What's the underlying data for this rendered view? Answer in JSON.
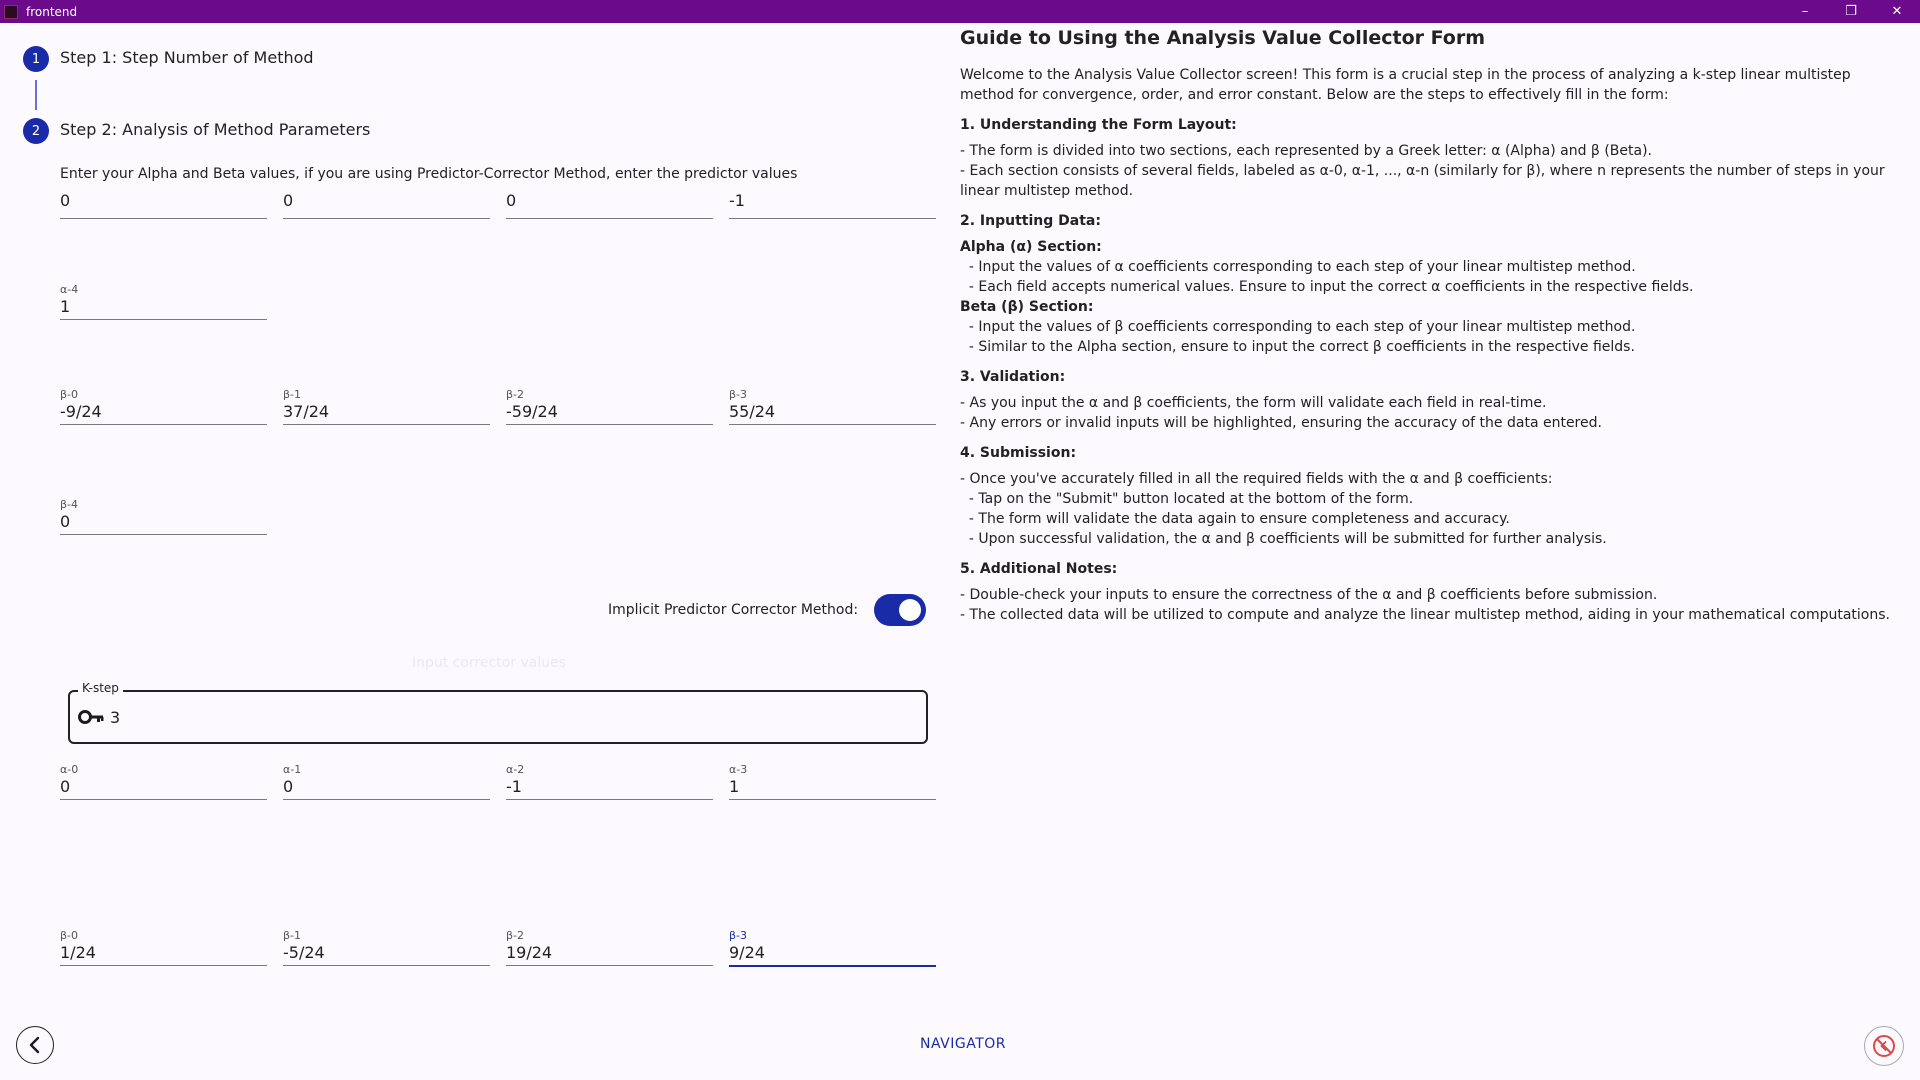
{
  "window": {
    "title": "frontend",
    "controls": [
      "–",
      "❐",
      "✕"
    ]
  },
  "stepper": {
    "steps": [
      {
        "number": "1",
        "label": "Step 1: Step Number of Method"
      },
      {
        "number": "2",
        "label": "Step 2: Analysis of Method Parameters"
      }
    ]
  },
  "form": {
    "instruction": "Enter your Alpha and Beta values, if you are using Predictor-Corrector Method, enter the predictor values",
    "predictor_alpha": [
      {
        "label": "",
        "value": "0"
      },
      {
        "label": "",
        "value": "0"
      },
      {
        "label": "",
        "value": "0"
      },
      {
        "label": "",
        "value": "-1"
      },
      {
        "label": "α-4",
        "value": "1"
      }
    ],
    "predictor_beta": [
      {
        "label": "β-0",
        "value": "-9/24"
      },
      {
        "label": "β-1",
        "value": "37/24"
      },
      {
        "label": "β-2",
        "value": "-59/24"
      },
      {
        "label": "β-3",
        "value": "55/24"
      },
      {
        "label": "β-4",
        "value": "0"
      }
    ],
    "toggle": {
      "label": "Implicit Predictor Corrector Method:",
      "state": "on"
    },
    "faded_text": "Input corrector values",
    "kstep": {
      "label": "K-step",
      "value": "3",
      "icon": "key-icon"
    },
    "corrector_alpha": [
      {
        "label": "α-0",
        "value": "0"
      },
      {
        "label": "α-1",
        "value": "0"
      },
      {
        "label": "α-2",
        "value": "-1"
      },
      {
        "label": "α-3",
        "value": "1"
      }
    ],
    "corrector_beta": [
      {
        "label": "β-0",
        "value": "1/24"
      },
      {
        "label": "β-1",
        "value": "-5/24"
      },
      {
        "label": "β-2",
        "value": "19/24"
      },
      {
        "label": "β-3",
        "value": "9/24"
      }
    ]
  },
  "guide": {
    "title": "Guide to Using the Analysis Value Collector Form",
    "intro": "Welcome to the Analysis Value Collector screen! This form is a crucial step in the process of analyzing a k-step linear multistep method for convergence, order, and error constant. Below are the steps to effectively fill in the form:",
    "s1_heading": "1. Understanding the Form Layout:",
    "s1_l1": "- The form is divided into two sections, each represented by a Greek letter: α (Alpha) and β (Beta).",
    "s1_l2": "- Each section consists of several fields, labeled as α-0, α-1, ..., α-n (similarly for β), where n represents the number of steps in your linear multistep method.",
    "s2_heading": "2. Inputting Data:",
    "s2_alpha": "Alpha (α) Section:",
    "s2_a1": "  - Input the values of α coefficients corresponding to each step of your linear multistep method.",
    "s2_a2": "  - Each field accepts numerical values. Ensure to input the correct α coefficients in the respective fields.",
    "s2_beta": "Beta (β) Section:",
    "s2_b1": "  - Input the values of β coefficients corresponding to each step of your linear multistep method.",
    "s2_b2": "  - Similar to the Alpha section, ensure to input the correct β coefficients in the respective fields.",
    "s3_heading": "3. Validation:",
    "s3_l1": "- As you input the α and β coefficients, the form will validate each field in real-time.",
    "s3_l2": "- Any errors or invalid inputs will be highlighted, ensuring the accuracy of the data entered.",
    "s4_heading": "4. Submission:",
    "s4_l1": "- Once you've accurately filled in all the required fields with the α and β coefficients:",
    "s4_l2": "  - Tap on the \"Submit\" button located at the bottom of the form.",
    "s4_l3": "  - The form will validate the data again to ensure completeness and accuracy.",
    "s4_l4": "  - Upon successful validation, the α and β coefficients will be submitted for further analysis.",
    "s5_heading": "5. Additional Notes:",
    "s5_l1": "- Double-check your inputs to ensure the correctness of the α and β coefficients before submission.",
    "s5_l2": "- The collected data will be utilized to compute and analyze the linear multistep method, aiding in your mathematical computations."
  },
  "footer": {
    "navigator_label": "NAVIGATOR"
  },
  "colors": {
    "titlebar": "#6b0a8a",
    "accent": "#1a2ba8",
    "background": "#fcf9ff"
  }
}
